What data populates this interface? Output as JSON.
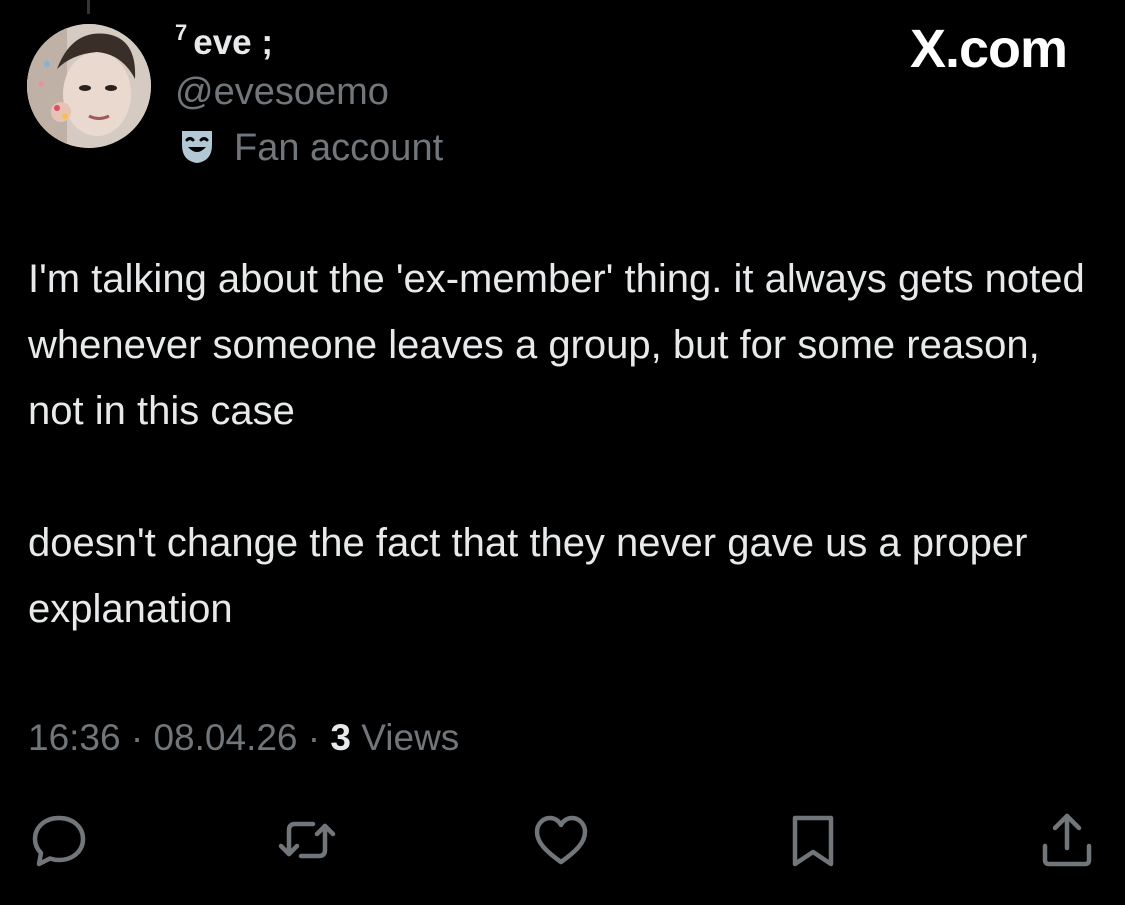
{
  "author": {
    "display_name_sup": "7",
    "display_name": "eve ;",
    "handle": "@evesoemo",
    "label_icon": "theater-mask-icon",
    "label": "Fan account"
  },
  "brand": {
    "site": "X.com"
  },
  "tweet": {
    "paragraphs": [
      "I'm talking about the 'ex-member' thing. it always gets noted whenever someone leaves a group, but for some reason, not in this case",
      "doesn't change the fact that they never gave us a proper explanation"
    ]
  },
  "meta": {
    "time": "16:36",
    "sep1": " · ",
    "date": "08.04.26",
    "sep2": " · ",
    "views_count": "3",
    "views_label": " Views"
  },
  "actions": [
    {
      "name": "reply",
      "icon": "reply-icon"
    },
    {
      "name": "repost",
      "icon": "repost-icon"
    },
    {
      "name": "like",
      "icon": "heart-icon"
    },
    {
      "name": "bookmark",
      "icon": "bookmark-icon"
    },
    {
      "name": "share",
      "icon": "share-icon"
    }
  ],
  "colors": {
    "background": "#000000",
    "primary_text": "#e7e9ea",
    "secondary_text": "#71767b",
    "label_icon_bg": "#b2c8d4"
  }
}
